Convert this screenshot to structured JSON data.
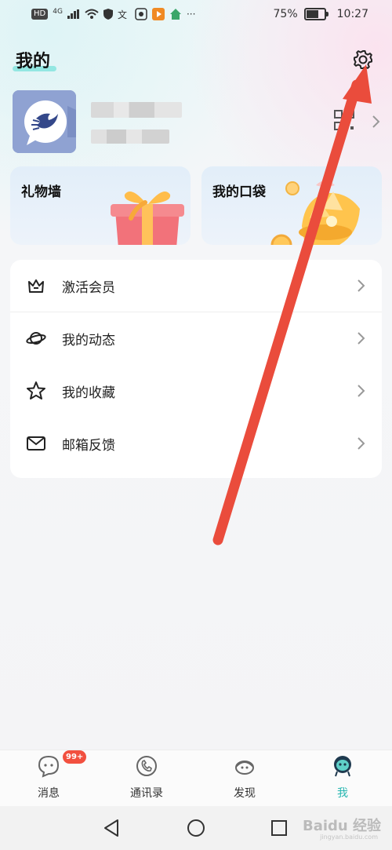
{
  "status_bar": {
    "left_chips": [
      "HD",
      "4G"
    ],
    "battery": "75%",
    "battery_level": 0.75,
    "time": "10:27"
  },
  "header": {
    "title": "我的"
  },
  "profile": {
    "name_masked": "",
    "id_masked": ""
  },
  "cards": [
    {
      "label": "礼物墙"
    },
    {
      "label": "我的口袋"
    }
  ],
  "menu": {
    "items": [
      {
        "label": "激活会员",
        "icon": "crown-icon"
      },
      {
        "label": "我的动态",
        "icon": "planet-icon"
      },
      {
        "label": "我的收藏",
        "icon": "star-icon"
      },
      {
        "label": "邮箱反馈",
        "icon": "mail-icon"
      }
    ]
  },
  "bottom_nav": {
    "items": [
      {
        "label": "消息",
        "icon": "message-icon",
        "badge": "99+"
      },
      {
        "label": "通讯录",
        "icon": "contacts-icon"
      },
      {
        "label": "发现",
        "icon": "discover-icon"
      },
      {
        "label": "我",
        "icon": "me-icon",
        "active": true
      }
    ]
  },
  "colors": {
    "accent": "#27b6b0",
    "badge": "#f2503f",
    "annotation_arrow": "#ea4c3c"
  },
  "watermark": {
    "text": "Baidu 经验",
    "sub": "jingyan.baidu.com"
  }
}
